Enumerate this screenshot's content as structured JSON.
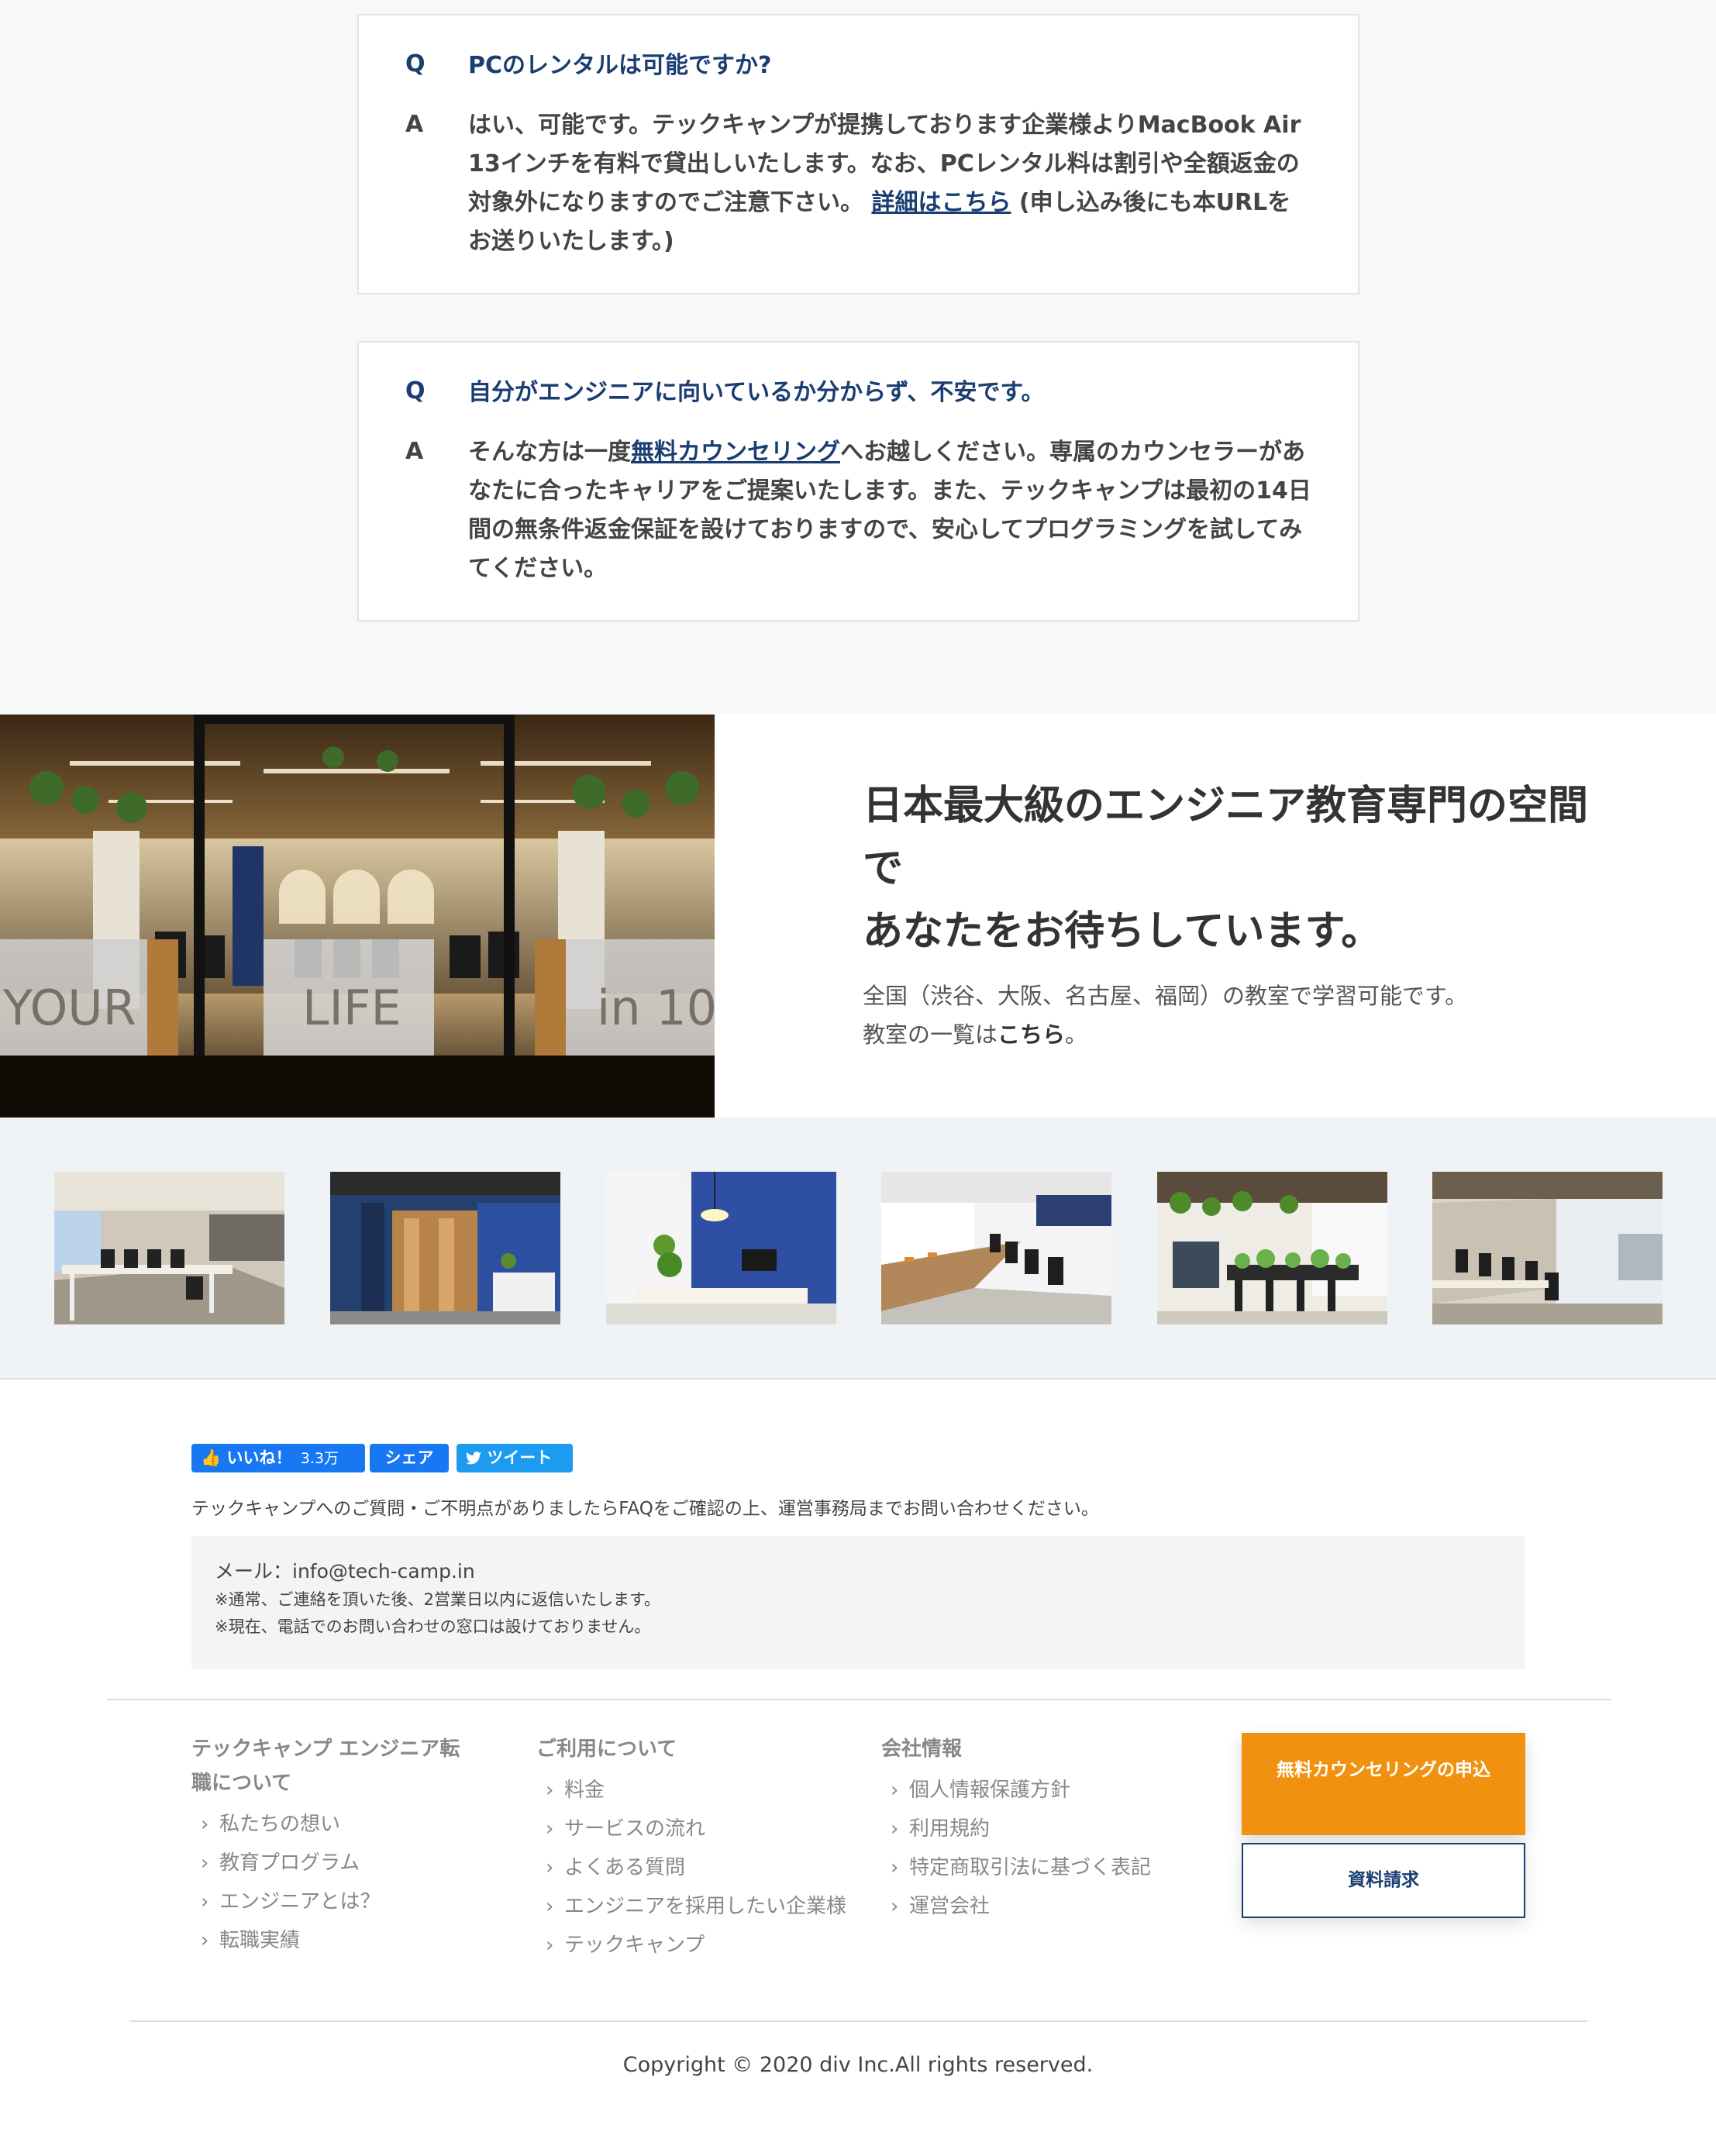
{
  "faq": [
    {
      "q_letter": "Q",
      "question": "PCのレンタルは可能ですか?",
      "a_letter": "A",
      "answer_before": "はい、可能です。テックキャンプが提携しております企業様よりMacBook Air 13インチを有料で貸出しいたします。なお、PCレンタル料は割引や全額返金の対象外になりますのでご注意下さい。",
      "answer_link": "詳細はこちら",
      "answer_after": "(申し込み後にも本URLをお送りいたします。)"
    },
    {
      "q_letter": "Q",
      "question": "自分がエンジニアに向いているか分からず、不安です。",
      "a_letter": "A",
      "answer_before": "そんな方は一度",
      "answer_link": "無料カウンセリング",
      "answer_after": "へお越しください。専属のカウンセラーがあなたに合ったキャリアをご提案いたします。また、テックキャンプは最初の14日間の無条件返金保証を設けておりますので、安心してプログラミングを試してみてください。"
    }
  ],
  "hero": {
    "title_line1": "日本最大級のエンジニア教育専門の空間で",
    "title_line2": "あなたをお待ちしています。",
    "sub_line1": "全国（渋谷、大阪、名古屋、福岡）の教室で学習可能です。",
    "sub_prefix": "教室の一覧は",
    "sub_link": "こちら",
    "sub_suffix": "。",
    "photo_glass_text": [
      "YOUR",
      "LIFE",
      "in 10"
    ]
  },
  "social": {
    "like_label": "いいね！",
    "like_count": "3.3万",
    "share_label": "シェア",
    "tweet_label": "ツイート"
  },
  "contact": {
    "note": "テックキャンプへのご質問・ご不明点がありましたらFAQをご確認の上、運営事務局までお問い合わせください。",
    "mail": "メール：info@tech-camp.in",
    "note1": "※通常、ご連絡を頂いた後、2営業日以内に返信いたします。",
    "note2": "※現在、電話でのお問い合わせの窓口は設けておりません。"
  },
  "footer": {
    "columns": [
      {
        "heading": "テックキャンプ エンジニア転職について",
        "items": [
          "私たちの想い",
          "教育プログラム",
          "エンジニアとは？",
          "転職実績"
        ]
      },
      {
        "heading": "ご利用について",
        "items": [
          "料金",
          "サービスの流れ",
          "よくある質問",
          "エンジニアを採用したい企業様",
          "テックキャンプ"
        ]
      },
      {
        "heading": "会社情報",
        "items": [
          "個人情報保護方針",
          "利用規約",
          "特定商取引法に基づく表記",
          "運営会社"
        ]
      }
    ],
    "chevron": "›",
    "cta_primary": "無料カウンセリングの申込",
    "cta_secondary": "資料請求",
    "copyright": "Copyright © 2020 div Inc.All rights reserved."
  },
  "colors": {
    "accent_navy": "#1a3d72",
    "cta_orange": "#f0920f",
    "facebook_blue": "#1877f2",
    "twitter_blue": "#1d9bf0"
  },
  "icons": {
    "like": "thumbs-up-icon",
    "tweet": "twitter-bird-icon"
  }
}
